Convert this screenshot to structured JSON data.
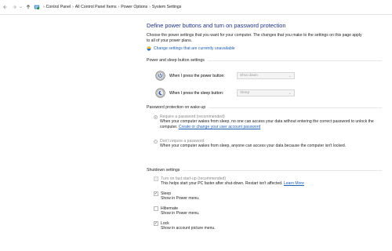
{
  "breadcrumb": {
    "items": [
      "Control Panel",
      "All Control Panel Items",
      "Power Options",
      "System Settings"
    ]
  },
  "page": {
    "title": "Define power buttons and turn on password protection",
    "intro": "Choose the power settings that you want for your computer. The changes that you make to the settings on this page apply to all of your power plans.",
    "change_link": "Change settings that are currently unavailable"
  },
  "power_buttons": {
    "heading": "Power and sleep button settings",
    "power_label": "When I press the power button:",
    "power_value": "Shut down",
    "sleep_label": "When I press the sleep button:",
    "sleep_value": "Sleep"
  },
  "password": {
    "heading": "Password protection on wake-up",
    "require_label": "Require a password (recommended)",
    "require_desc": "When your computer wakes from sleep, no one can access your data without entering the correct password to unlock the computer.",
    "require_link": "Create or change your user account password",
    "norequire_label": "Don't require a password",
    "norequire_desc": "When your computer wakes from sleep, anyone can access your data because the computer isn't locked.",
    "selected": "require"
  },
  "shutdown": {
    "heading": "Shutdown settings",
    "items": [
      {
        "label": "Turn on fast start-up (recommended)",
        "desc": "This helps start your PC faster after shut-down. Restart isn't affected.",
        "link": "Learn More",
        "checked": false,
        "disabled": true
      },
      {
        "label": "Sleep",
        "desc": "Show in Power menu.",
        "checked": true,
        "disabled": false
      },
      {
        "label": "Hibernate",
        "desc": "Show in Power menu.",
        "checked": false,
        "disabled": false
      },
      {
        "label": "Lock",
        "desc": "Show in account picture menu.",
        "checked": true,
        "disabled": false
      }
    ]
  },
  "colors": {
    "title": "#1e3287",
    "link": "#1f5fb4"
  },
  "icons": {
    "shield": "uac-shield-icon",
    "power": "power-button-icon",
    "sleep": "sleep-button-icon"
  }
}
